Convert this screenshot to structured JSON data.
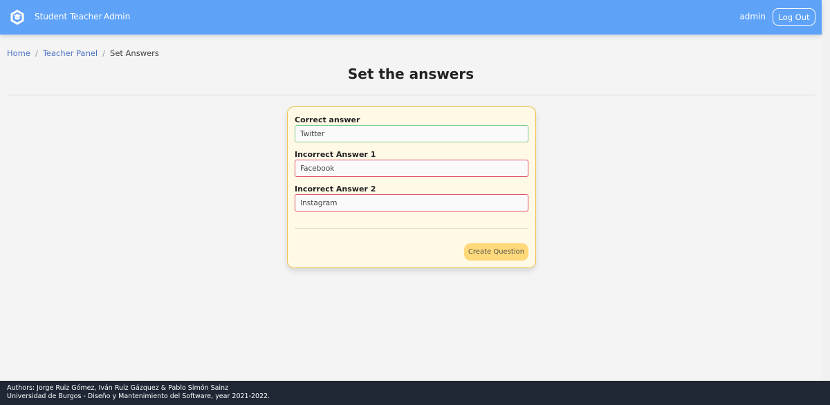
{
  "navbar": {
    "logo_icon": "graduation-cap-icon",
    "links": [
      "Student",
      "Teacher",
      "Admin"
    ],
    "user": "admin",
    "logout_label": "Log Out",
    "bg_color": "#5fa3f9"
  },
  "breadcrumb": {
    "home": "Home",
    "teacher_panel": "Teacher Panel",
    "current": "Set Answers",
    "separator": "/"
  },
  "page": {
    "title": "Set the answers"
  },
  "form": {
    "correct_label": "Correct answer",
    "correct_value": "Twitter",
    "incorrect1_label": "Incorrect Answer 1",
    "incorrect1_value": "Facebook",
    "incorrect2_label": "Incorrect Answer 2",
    "incorrect2_value": "Instagram",
    "submit_label": "Create Question",
    "accent_color": "#f2c14e",
    "correct_color": "#7fc98a",
    "incorrect_color": "#e0556a"
  },
  "footer": {
    "line1": "Authors: Jorge Ruiz Gómez, Iván Ruiz Gázquez & Pablo Simón Sainz",
    "line2": "Universidad de Burgos - Diseño y Mantenimiento del Software, year 2021-2022."
  }
}
